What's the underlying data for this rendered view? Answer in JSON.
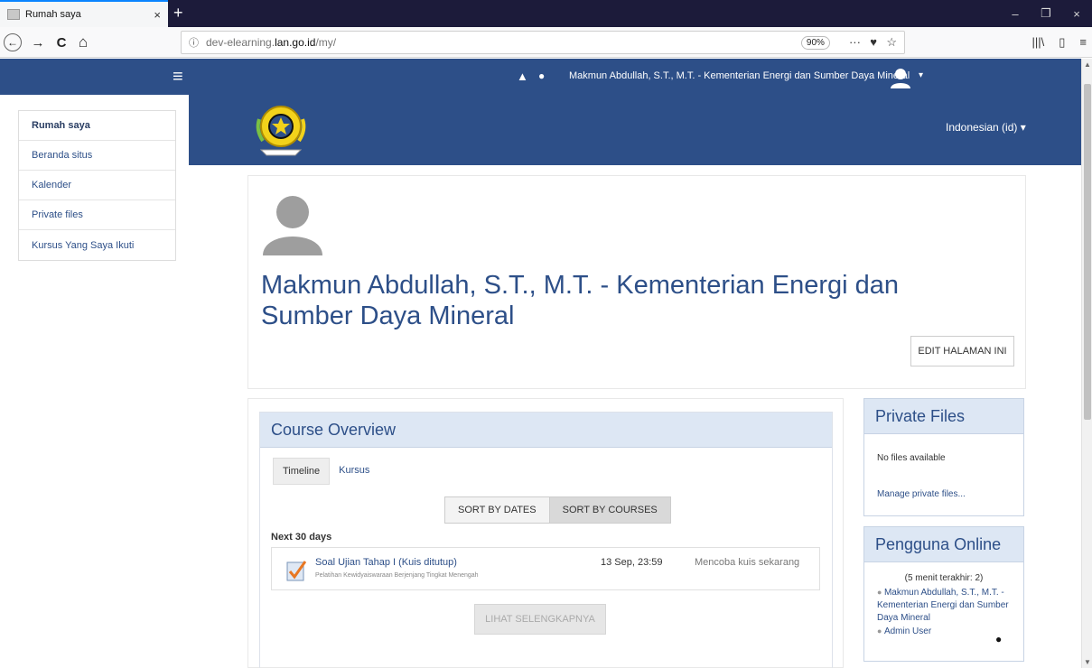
{
  "browser": {
    "tab_title": "Rumah saya",
    "tab_close": "×",
    "new_tab": "+",
    "url_domain_prefix": "dev-elearning.",
    "url_domain": "lan.go.id",
    "url_path": "/my/",
    "zoom": "90%",
    "info_icon": "ⓘ",
    "more_icon": "···",
    "pocket_icon": "♥",
    "star_icon": "☆",
    "library_icon": "|||\\",
    "sidebar_icon": "▯",
    "menu_icon": "≡",
    "win_min": "–",
    "win_restore": "❐",
    "win_close": "×",
    "back_icon": "←",
    "forward_icon": "→",
    "reload_icon": "C",
    "home_icon": "⌂"
  },
  "topnav": {
    "hamburger": "≡",
    "bell": "▲",
    "chat": "●",
    "username": "Makmun Abdullah, S.T., M.T. - Kementerian Energi dan Sumber Daya Mineral",
    "caret": "▾"
  },
  "sidebar": {
    "items": [
      {
        "label": "Rumah saya"
      },
      {
        "label": "Beranda situs"
      },
      {
        "label": "Kalender"
      },
      {
        "label": "Private files"
      },
      {
        "label": "Kursus Yang Saya Ikuti"
      }
    ]
  },
  "header": {
    "language": "Indonesian (id) ▾"
  },
  "profile": {
    "name": "Makmun Abdullah, S.T., M.T. - Kementerian Energi dan Sumber Daya Mineral",
    "edit_button": "EDIT HALAMAN INI"
  },
  "overview": {
    "title": "Course Overview",
    "tabs": [
      "Timeline",
      "Kursus"
    ],
    "sort_dates": "SORT BY DATES",
    "sort_courses": "SORT BY COURSES",
    "period": "Next 30 days",
    "event": {
      "title": "Soal Ujian Tahap I (Kuis ditutup)",
      "course": "Pelatihan Kewidyaiswaraan Berjenjang Tingkat Menengah",
      "date": "13 Sep, 23:59",
      "action": "Mencoba kuis sekarang"
    },
    "more_button": "LIHAT SELENGKAPNYA"
  },
  "private_files": {
    "title": "Private Files",
    "empty": "No files available",
    "manage": "Manage private files..."
  },
  "online_users": {
    "title": "Pengguna Online",
    "last_minutes": "(5 menit terakhir: 2)",
    "users": [
      "Makmun Abdullah, S.T., M.T. - Kementerian Energi dan Sumber Daya Mineral",
      "Admin User"
    ]
  },
  "colors": {
    "brand": "#2d4f88",
    "block_header": "#dde7f4",
    "browser_chrome": "#1c1b3a"
  }
}
